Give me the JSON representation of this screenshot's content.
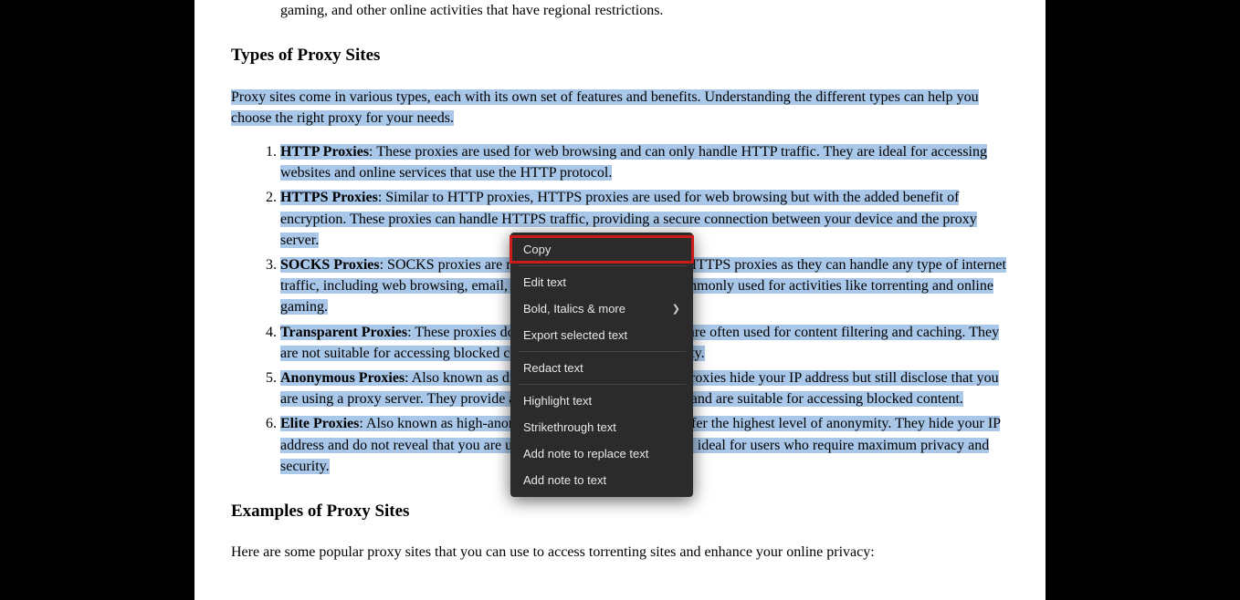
{
  "intro_tail": "gaming, and other online activities that have regional restrictions.",
  "heading_types": "Types of Proxy Sites",
  "types_intro": "Proxy sites come in various types, each with its own set of features and benefits. Understanding the different types can help you choose the right proxy for your needs.",
  "items": [
    {
      "title": "HTTP Proxies",
      "body": ": These proxies are used for web browsing and can only handle HTTP traffic. They are ideal for accessing websites and online services that use the HTTP protocol."
    },
    {
      "title": "HTTPS Proxies",
      "body": ": Similar to HTTP proxies, HTTPS proxies are used for web browsing but with the added benefit of encryption. These proxies can handle HTTPS traffic, providing a secure connection between your device and the proxy server."
    },
    {
      "title": "SOCKS Proxies",
      "body": ": SOCKS proxies are more versatile than HTTP and HTTPS proxies as they can handle any type of internet traffic, including web browsing, email, and file transfers. They are commonly used for activities like torrenting and online gaming."
    },
    {
      "title": "Transparent Proxies",
      "body": ": These proxies do not hide your IP address and are often used for content filtering and caching. They are not suitable for accessing blocked content or maintaining anonymity."
    },
    {
      "title": "Anonymous Proxies",
      "body": ": Also known as distorting proxies, anonymous proxies hide your IP address but still disclose that you are using a proxy server. They provide a moderate level of anonymity and are suitable for accessing blocked content."
    },
    {
      "title": "Elite Proxies",
      "body": ": Also known as high-anonymity proxies, elite proxies offer the highest level of anonymity. They hide your IP address and do not reveal that you are using a proxy. These proxies are ideal for users who require maximum privacy and security."
    }
  ],
  "heading_examples": "Examples of Proxy Sites",
  "examples_intro": "Here are some popular proxy sites that you can use to access torrenting sites and enhance your online privacy:",
  "ctx": {
    "copy": "Copy",
    "edit": "Edit text",
    "bold": "Bold, Italics & more",
    "export": "Export selected text",
    "redact": "Redact text",
    "highlight": "Highlight text",
    "strike": "Strikethrough text",
    "addnote_replace": "Add note to replace text",
    "addnote": "Add note to text"
  }
}
